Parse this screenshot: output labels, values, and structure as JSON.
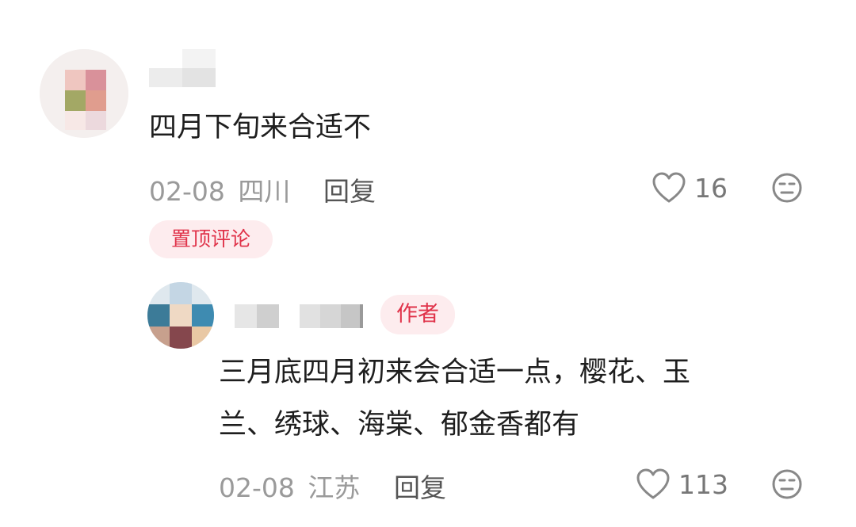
{
  "comments": [
    {
      "text": "四月下旬来合适不",
      "date": "02-08",
      "location": "四川",
      "reply_label": "回复",
      "likes": "16",
      "pinned_badge": "置顶评论"
    }
  ],
  "replies": [
    {
      "author_badge": "作者",
      "text_lines": [
        "三月底四月初来会合适一点，樱花、玉",
        "兰、绣球、海棠、郁金香都有"
      ],
      "date": "02-08",
      "location": "江苏",
      "reply_label": "回复",
      "likes": "113"
    }
  ],
  "colors": {
    "accent": "#e0334a",
    "badge_bg": "#fdecee",
    "meta_text": "#9a9a9a",
    "icon": "#888888"
  },
  "icons": [
    "heart-outline-icon",
    "dislike-face-icon"
  ]
}
